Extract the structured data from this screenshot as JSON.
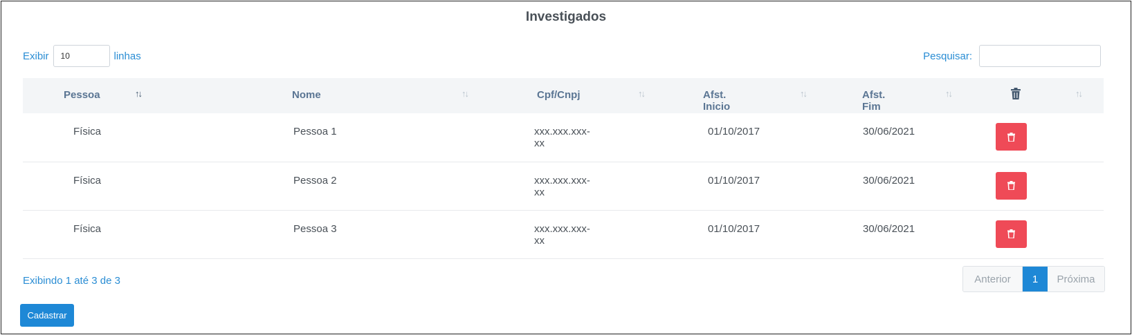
{
  "title": "Investigados",
  "length": {
    "prefix": "Exibir",
    "value": "10",
    "suffix": "linhas"
  },
  "search": {
    "label": "Pesquisar:",
    "value": ""
  },
  "columns": [
    {
      "label": "Pessoa",
      "sort": "↑↓"
    },
    {
      "label": "Nome",
      "sort": "↑↓"
    },
    {
      "label": "Cpf/Cnpj",
      "sort": "↑↓"
    },
    {
      "label": "Afst. Inicio",
      "sort": "↑↓"
    },
    {
      "label": "Afst. Fim",
      "sort": "↑↓"
    },
    {
      "icon": "trash-icon",
      "sort": "↑↓"
    }
  ],
  "rows": [
    {
      "pessoa": "Física",
      "nome": "Pessoa 1",
      "cpf": "xxx.xxx.xxx-xx",
      "inicio": "01/10/2017",
      "fim": "30/06/2021"
    },
    {
      "pessoa": "Física",
      "nome": "Pessoa 2",
      "cpf": "xxx.xxx.xxx-xx",
      "inicio": "01/10/2017",
      "fim": "30/06/2021"
    },
    {
      "pessoa": "Física",
      "nome": "Pessoa 3",
      "cpf": "xxx.xxx.xxx-xx",
      "inicio": "01/10/2017",
      "fim": "30/06/2021"
    }
  ],
  "info": "Exibindo 1 até 3 de 3",
  "pagination": {
    "prev": "Anterior",
    "current": "1",
    "next": "Próxima"
  },
  "actions": {
    "create": "Cadastrar"
  },
  "colors": {
    "accent": "#1e88d6",
    "danger": "#ef4a57",
    "link": "#2a8dd4",
    "header_bg": "#f3f5f7"
  }
}
